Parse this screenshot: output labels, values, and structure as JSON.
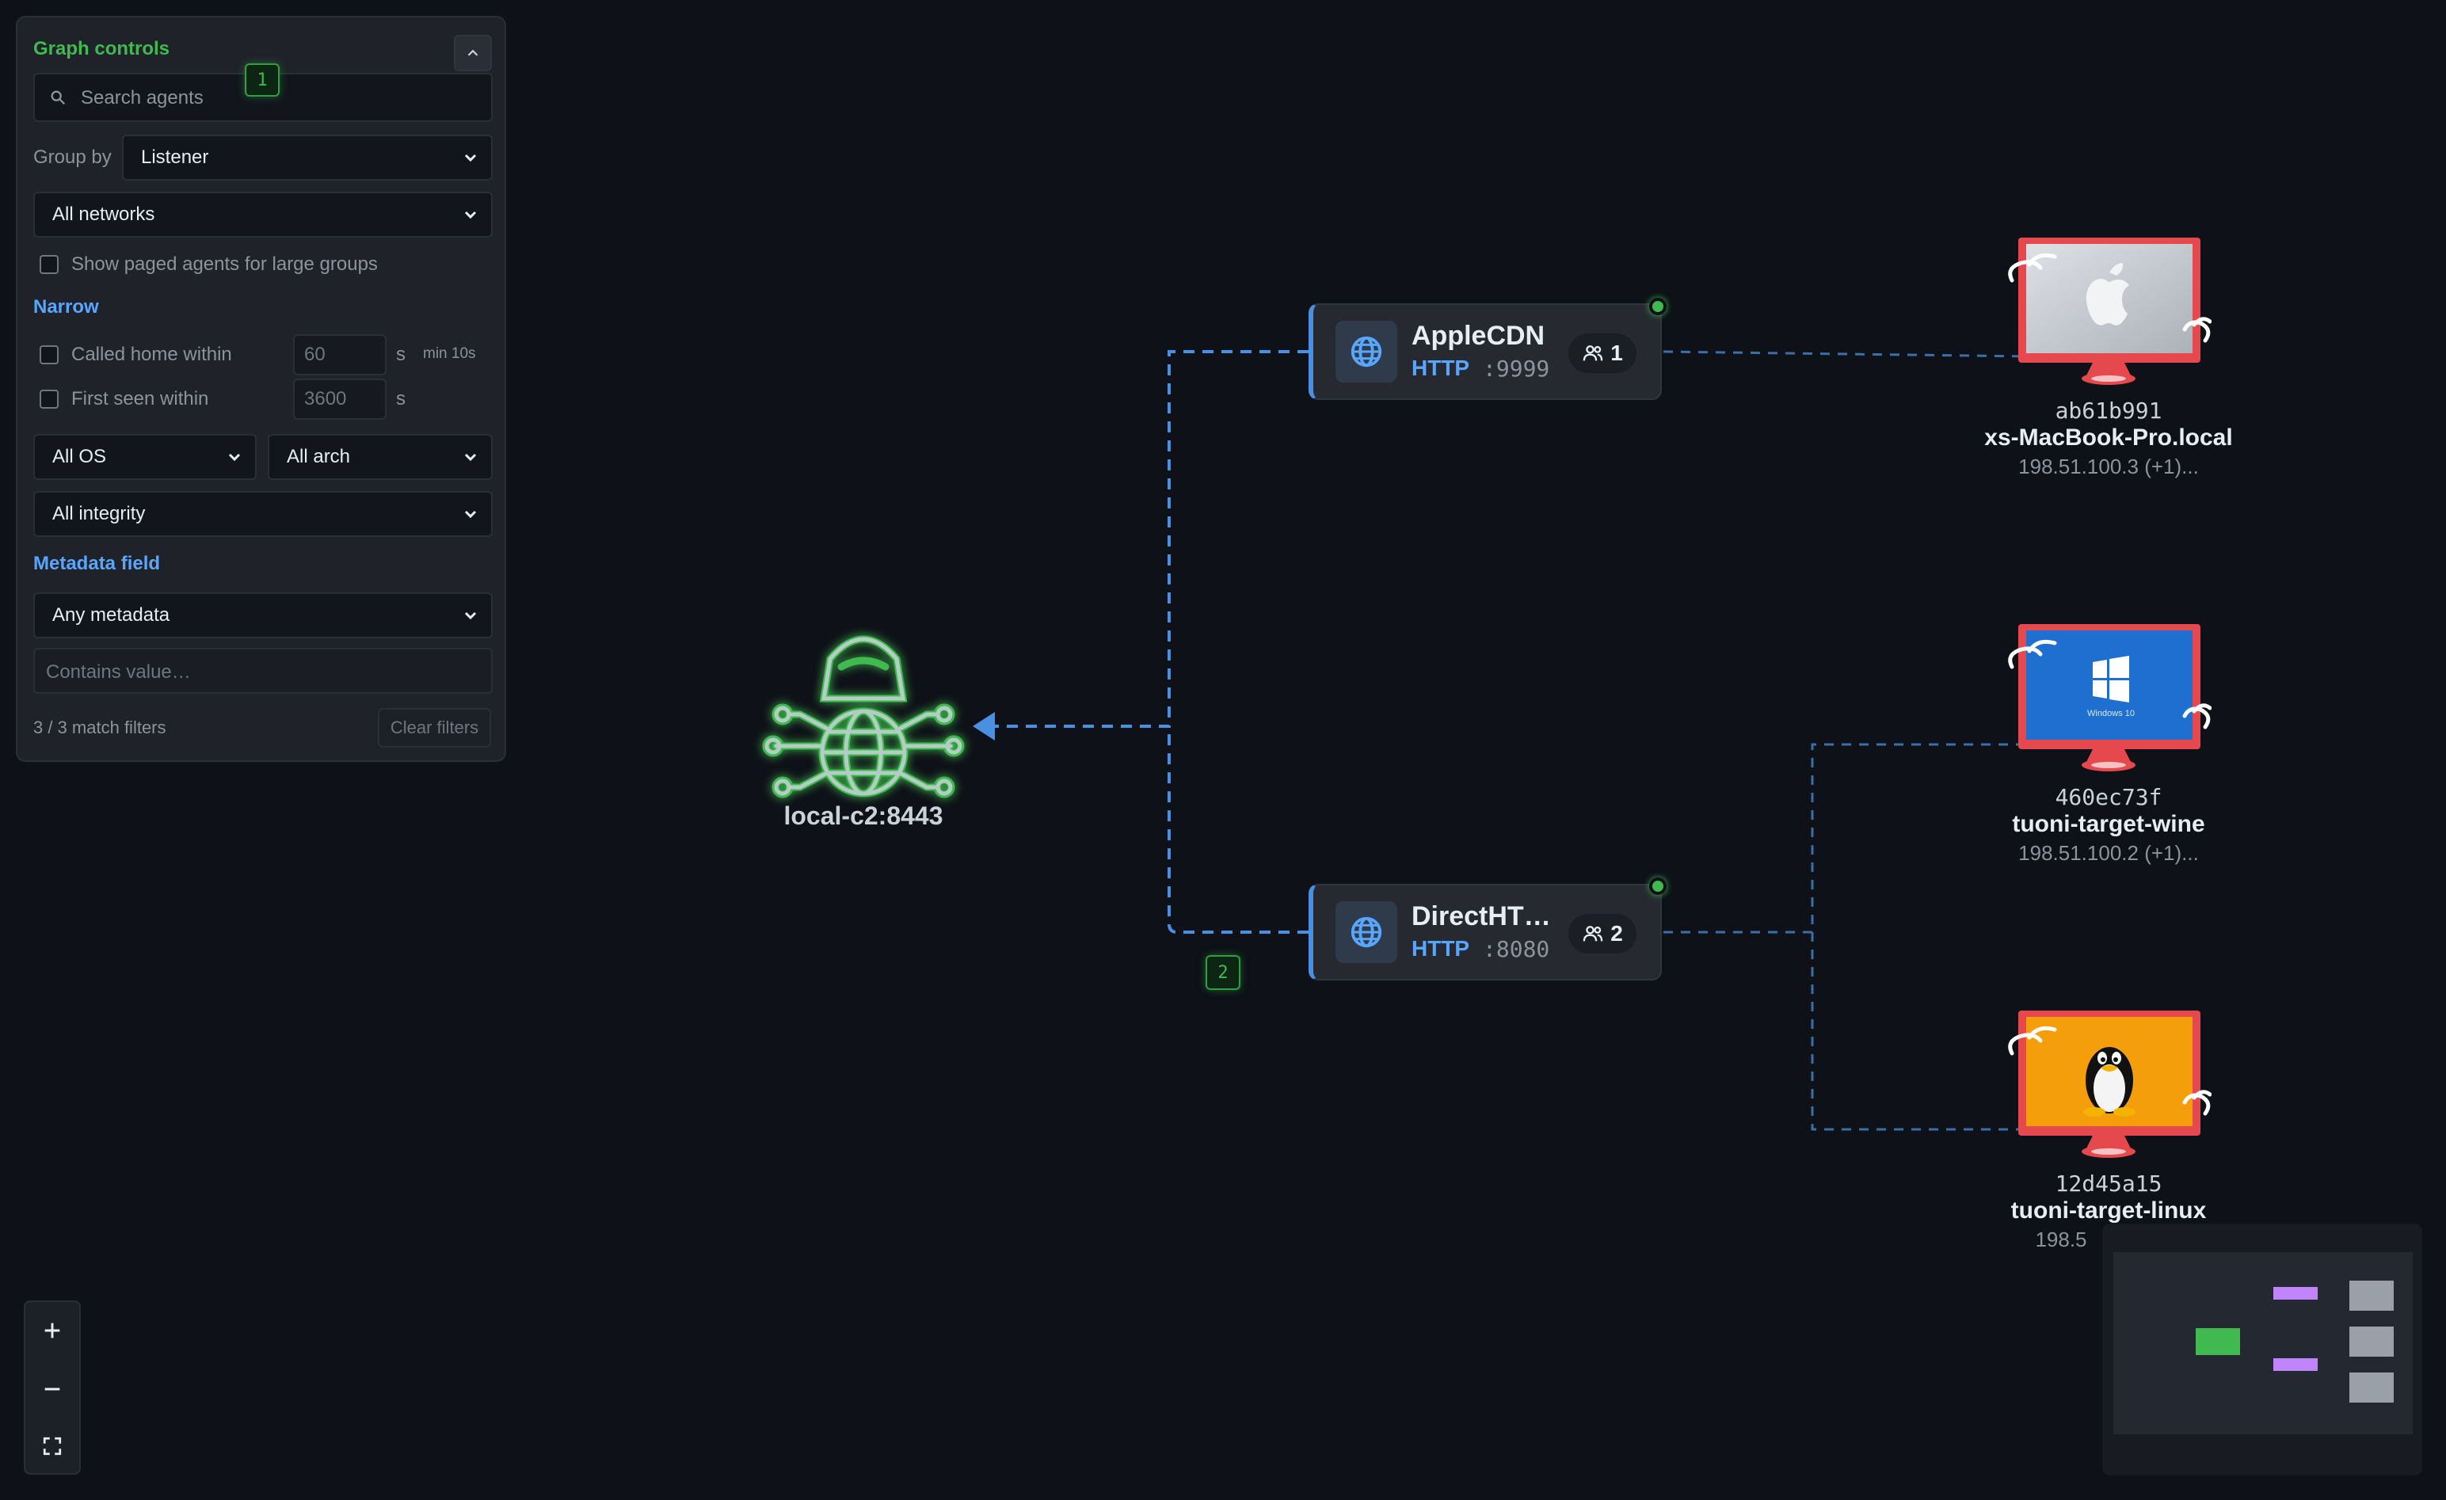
{
  "panel": {
    "title": "Graph controls",
    "search_placeholder": "Search agents",
    "marker_1": "1",
    "group_by_label": "Group by",
    "group_by_value": "Listener",
    "networks_value": "All networks",
    "show_paged_label": "Show paged agents for large groups",
    "narrow_heading": "Narrow",
    "called_home_label": "Called home within",
    "called_home_value": "60",
    "called_home_unit": "s",
    "called_home_hint": "min 10s",
    "first_seen_label": "First seen within",
    "first_seen_value": "3600",
    "first_seen_unit": "s",
    "os_value": "All OS",
    "arch_value": "All arch",
    "integrity_value": "All integrity",
    "metadata_heading": "Metadata field",
    "metadata_value": "Any metadata",
    "contains_placeholder": "Contains value…",
    "match_count": "3 / 3 match filters",
    "clear_label": "Clear filters"
  },
  "graph": {
    "server": {
      "label": "local-c2:8443",
      "color": "#3fb950"
    },
    "marker_2": "2",
    "listeners": [
      {
        "name": "AppleCDN",
        "protocol": "HTTP",
        "port": ":9999",
        "agents": "1"
      },
      {
        "name": "DirectHT…",
        "protocol": "HTTP",
        "port": ":8080",
        "agents": "2"
      }
    ],
    "agents": [
      {
        "id": "ab61b991",
        "host": "xs-MacBook-Pro.local",
        "ip": "198.51.100.3 (+1)...",
        "os_icon": "apple-logo-icon"
      },
      {
        "id": "460ec73f",
        "host": "tuoni-target-wine",
        "ip": "198.51.100.2 (+1)...",
        "os_icon": "windows-logo-icon",
        "os_caption": "Windows 10"
      },
      {
        "id": "12d45a15",
        "host": "tuoni-target-linux",
        "ip": "198.5",
        "os_icon": "linux-tux-icon"
      }
    ]
  },
  "colors": {
    "accent_green": "#3fb950",
    "accent_blue": "#58a6ff",
    "monitor_red": "#e5484d",
    "minimap_listener": "#c084fc",
    "minimap_server": "#3fb950",
    "minimap_agent": "#9aa0a8"
  }
}
